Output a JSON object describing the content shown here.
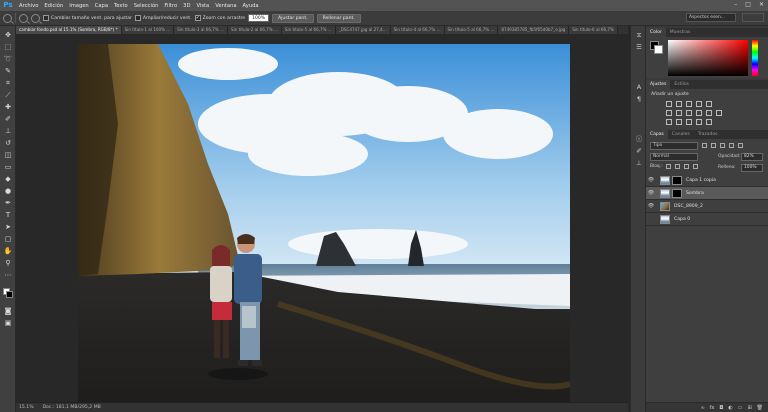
{
  "app": {
    "logo": "Ps"
  },
  "menu": [
    "Archivo",
    "Edición",
    "Imagen",
    "Capa",
    "Texto",
    "Selección",
    "Filtro",
    "3D",
    "Vista",
    "Ventana",
    "Ayuda"
  ],
  "window_controls": [
    "–",
    "□",
    "✕"
  ],
  "options": {
    "resize_windows_label": "Cambiar tamaño vent. para ajustar",
    "zoom_all_label": "Ampliar/reducir vent.",
    "scrubby_label": "Zoom con arrastre",
    "zoom_value": "100%",
    "fit_screen_button": "Ajustar pant.",
    "fill_screen_button": "Rellenar pant."
  },
  "workspace": {
    "search_placeholder": "Aspectos esen..."
  },
  "tabs": [
    "cambiar fondo.psd al 15.1% (Sombra, RGB/8*) *",
    "Sin título-1 al 100% ...",
    "Sin título-3 al 66,7% ...",
    "Sin título-2 al 66,7% ...",
    "Sin título-5 al 66,7% ...",
    "_DSC4747.jpg al 27,4...",
    "Sin título-4 al 66,7% ...",
    "Sin título-5 al 66,7% ...",
    "8749385785_fb5f65d0b7_o.jpg",
    "Sin título-6 al 66,7%"
  ],
  "status": {
    "zoom": "15.1%",
    "doc_info": "Doc.: 181,1 MB/295,2 MB"
  },
  "color_panel": {
    "tabs": [
      "Color",
      "Muestras"
    ],
    "foreground": "#000000",
    "background": "#ffffff"
  },
  "adjust_panel": {
    "tabs": [
      "Ajustes",
      "Estilos"
    ],
    "label": "Añadir un ajuste"
  },
  "layers_panel": {
    "tabs": [
      "Capas",
      "Canales",
      "Trazados"
    ],
    "kind_label": "Tipo",
    "blend_mode": "Normal",
    "opacity_label": "Opacidad:",
    "opacity_value": "82%",
    "lock_label": "Bloq.:",
    "fill_label": "Relleno:",
    "fill_value": "100%",
    "layers": [
      {
        "name": "Capa 1 copia",
        "visible": true,
        "has_mask": true,
        "selected": false
      },
      {
        "name": "Sombra",
        "visible": true,
        "has_mask": true,
        "selected": true
      },
      {
        "name": "DSC_8909_2",
        "visible": true,
        "has_mask": false,
        "selected": false
      },
      {
        "name": "Capa 0",
        "visible": false,
        "has_mask": false,
        "selected": false
      }
    ],
    "bottom_icons": [
      "link-icon",
      "fx-icon",
      "mask-icon",
      "adjustment-icon",
      "folder-icon",
      "new-layer-icon",
      "trash-icon"
    ]
  },
  "tools": [
    "move",
    "marquee",
    "lasso",
    "quick-select",
    "crop",
    "eyedropper",
    "healing",
    "brush",
    "clone-stamp",
    "history-brush",
    "eraser",
    "gradient",
    "blur",
    "dodge",
    "pen",
    "type",
    "path-select",
    "shape",
    "hand",
    "zoom"
  ]
}
